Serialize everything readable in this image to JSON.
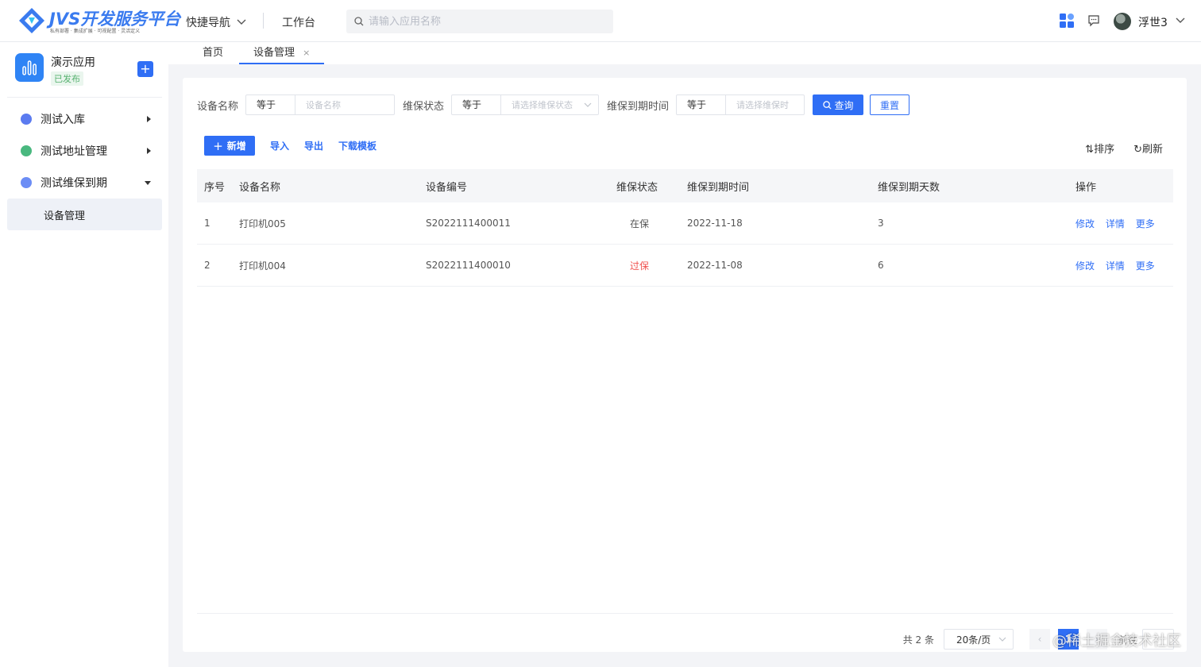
{
  "brand": {
    "name": "JVS开发服务平台",
    "tagline": "私有部署 · 集成扩展 · 可视配置 · 灵活定义",
    "primary_color": "#2f6ef5"
  },
  "header": {
    "quick_nav": "快捷导航",
    "workbench": "工作台",
    "search_placeholder": "请输入应用名称",
    "username": "浮世3"
  },
  "sidebar": {
    "app_name": "演示应用",
    "app_status": "已发布",
    "add_label": "+",
    "items": [
      {
        "label": "测试入库",
        "icon_color": "#5b7bf0",
        "expanded": false
      },
      {
        "label": "测试地址管理",
        "icon_color": "#49b87f",
        "expanded": false
      },
      {
        "label": "测试维保到期",
        "icon_color": "#6c8df5",
        "expanded": true
      }
    ],
    "subitems": [
      {
        "label": "设备管理",
        "active": true
      }
    ]
  },
  "tabs": [
    {
      "label": "首页",
      "active": false
    },
    {
      "label": "设备管理",
      "active": true,
      "close": "×"
    }
  ],
  "filters": {
    "device_name_label": "设备名称",
    "device_name_op": "等于",
    "device_name_placeholder": "设备名称",
    "status_label": "维保状态",
    "status_op": "等于",
    "status_placeholder": "请选择维保状态",
    "expire_label": "维保到期时间",
    "expire_op": "等于",
    "expire_placeholder": "请选择维保时",
    "query": "查询",
    "reset": "重置"
  },
  "actions": {
    "add": "新增",
    "import": "导入",
    "export": "导出",
    "template": "下载模板",
    "sort": "排序",
    "refresh": "刷新"
  },
  "table": {
    "columns": [
      "序号",
      "设备名称",
      "设备编号",
      "维保状态",
      "维保到期时间",
      "维保到期天数",
      "操作"
    ],
    "rows": [
      {
        "index": "1",
        "name": "打印机005",
        "code": "S2022111400011",
        "status": "在保",
        "status_color": "#555555",
        "expire": "2022-11-18",
        "days": "3"
      },
      {
        "index": "2",
        "name": "打印机004",
        "code": "S2022111400010",
        "status": "过保",
        "status_color": "#f0524f",
        "expire": "2022-11-08",
        "days": "6"
      }
    ],
    "row_ops": [
      "修改",
      "详情",
      "更多"
    ]
  },
  "pagination": {
    "total": "共 2 条",
    "page_size": "20条/页",
    "current_page": "1",
    "jump": "前往"
  },
  "watermark": "@稀土掘金技术社区"
}
